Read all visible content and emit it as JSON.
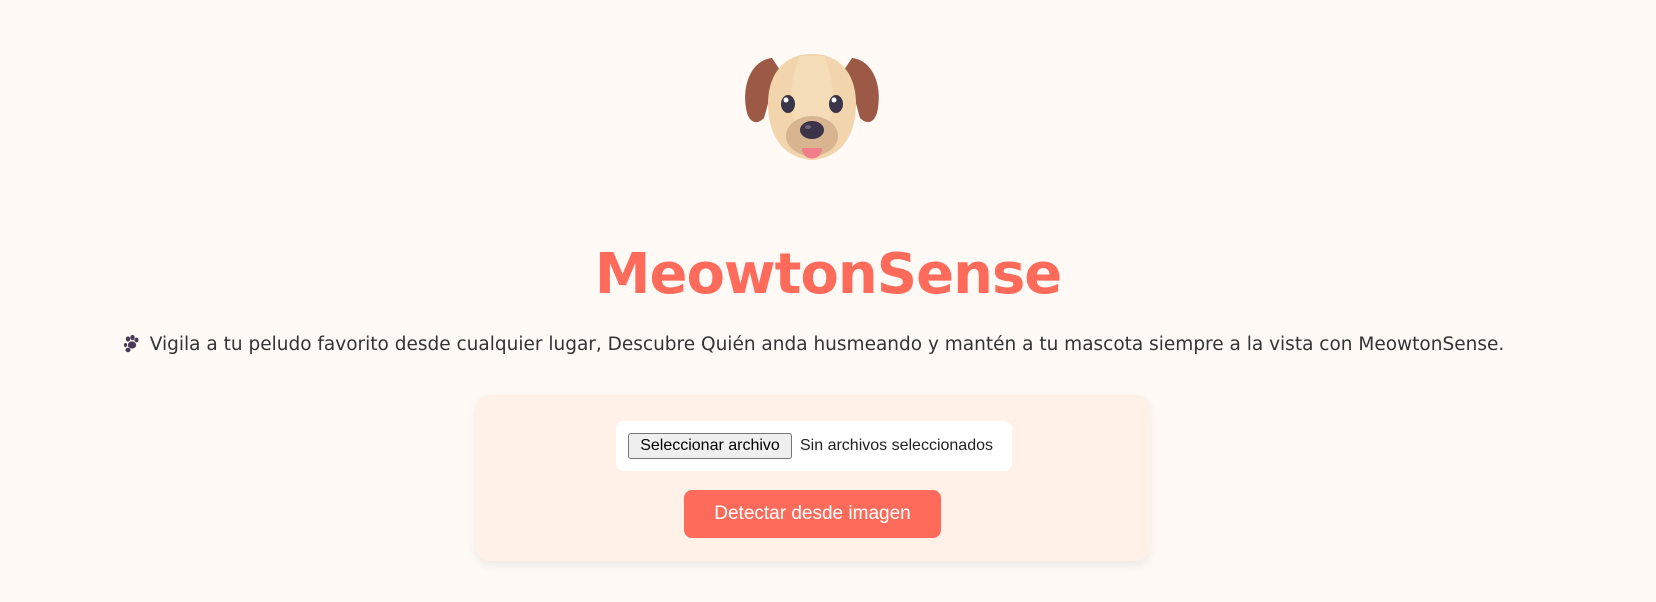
{
  "header": {
    "logo_icon": "dog-face-icon",
    "title": "MeowtonSense",
    "subtitle_icon": "paw-prints-icon",
    "subtitle": "Vigila a tu peludo favorito desde cualquier lugar, Descubre Quién anda husmeando y mantén a tu mascota siempre a la vista con MeowtonSense."
  },
  "upload": {
    "file_button_label": "Seleccionar archivo",
    "file_status": "Sin archivos seleccionados",
    "detect_button_label": "Detectar desde imagen"
  },
  "colors": {
    "background": "#fffaf6",
    "accent": "#ff6b5b",
    "panel": "#fff0e8"
  }
}
